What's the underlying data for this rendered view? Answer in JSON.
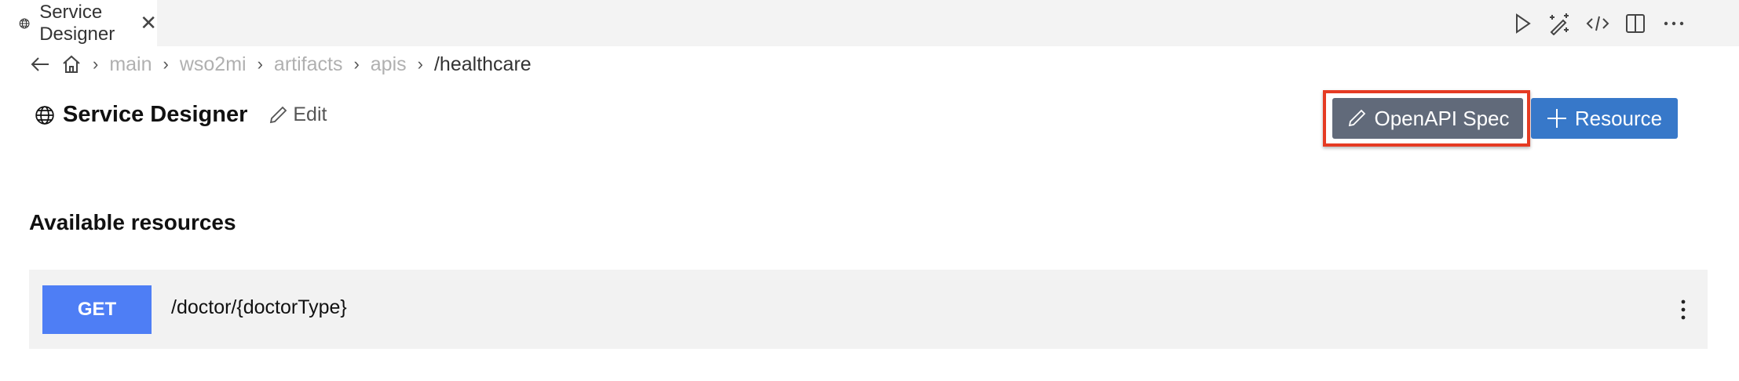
{
  "tab": {
    "title": "Service Designer",
    "close": "✕"
  },
  "toolbar": {
    "icons": [
      "play-icon",
      "magic-wand-icon",
      "code-icon",
      "split-editor-icon",
      "more-icon"
    ]
  },
  "breadcrumb": {
    "items": [
      "main",
      "wso2mi",
      "artifacts",
      "apis"
    ],
    "current": "/healthcare"
  },
  "header": {
    "title": "Service Designer",
    "edit_label": "Edit"
  },
  "actions": {
    "openapi_label": "OpenAPI Spec",
    "resource_label": "Resource"
  },
  "resources": {
    "heading": "Available resources",
    "items": [
      {
        "method": "GET",
        "path": "/doctor/{doctorType}"
      }
    ]
  },
  "colors": {
    "get": "#4e7ef5",
    "primary": "#3778c9",
    "secondary": "#616a7a",
    "highlight": "#e53b23"
  }
}
